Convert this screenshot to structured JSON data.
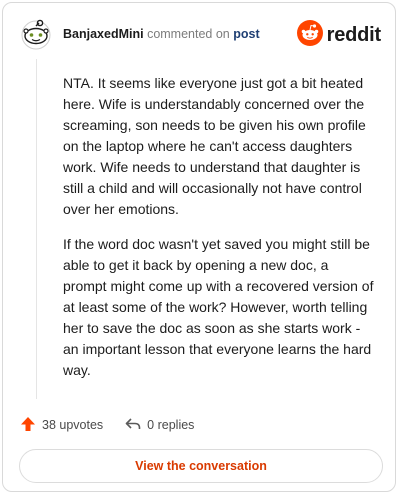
{
  "comment": {
    "username": "BanjaxedMini",
    "action_text": "commented on",
    "post_link": "post",
    "paragraphs": [
      "NTA. It seems like everyone just got a bit heated here. Wife is understandably concerned over the screaming, son needs to be given his own profile on the laptop where he can't access daughters work. Wife needs to understand that daughter is still a child and will occasionally not have control over her emotions.",
      "If the word doc wasn't yet saved you might still be able to get it back by opening a new doc, a prompt might come up with a recovered version of at least some of the work? However, worth telling her to save the doc as soon as she starts work - an important lesson that everyone learns the hard way."
    ],
    "upvotes_label": "38 upvotes",
    "replies_label": "0 replies"
  },
  "brand": {
    "wordmark": "reddit",
    "color": "#ff4500"
  },
  "cta": {
    "label": "View the conversation",
    "color": "#d93a00"
  },
  "icons": {
    "avatar": "snoo-avatar-icon",
    "logo": "reddit-logo-icon",
    "upvote": "upvote-arrow-icon",
    "reply": "reply-arrow-icon"
  }
}
